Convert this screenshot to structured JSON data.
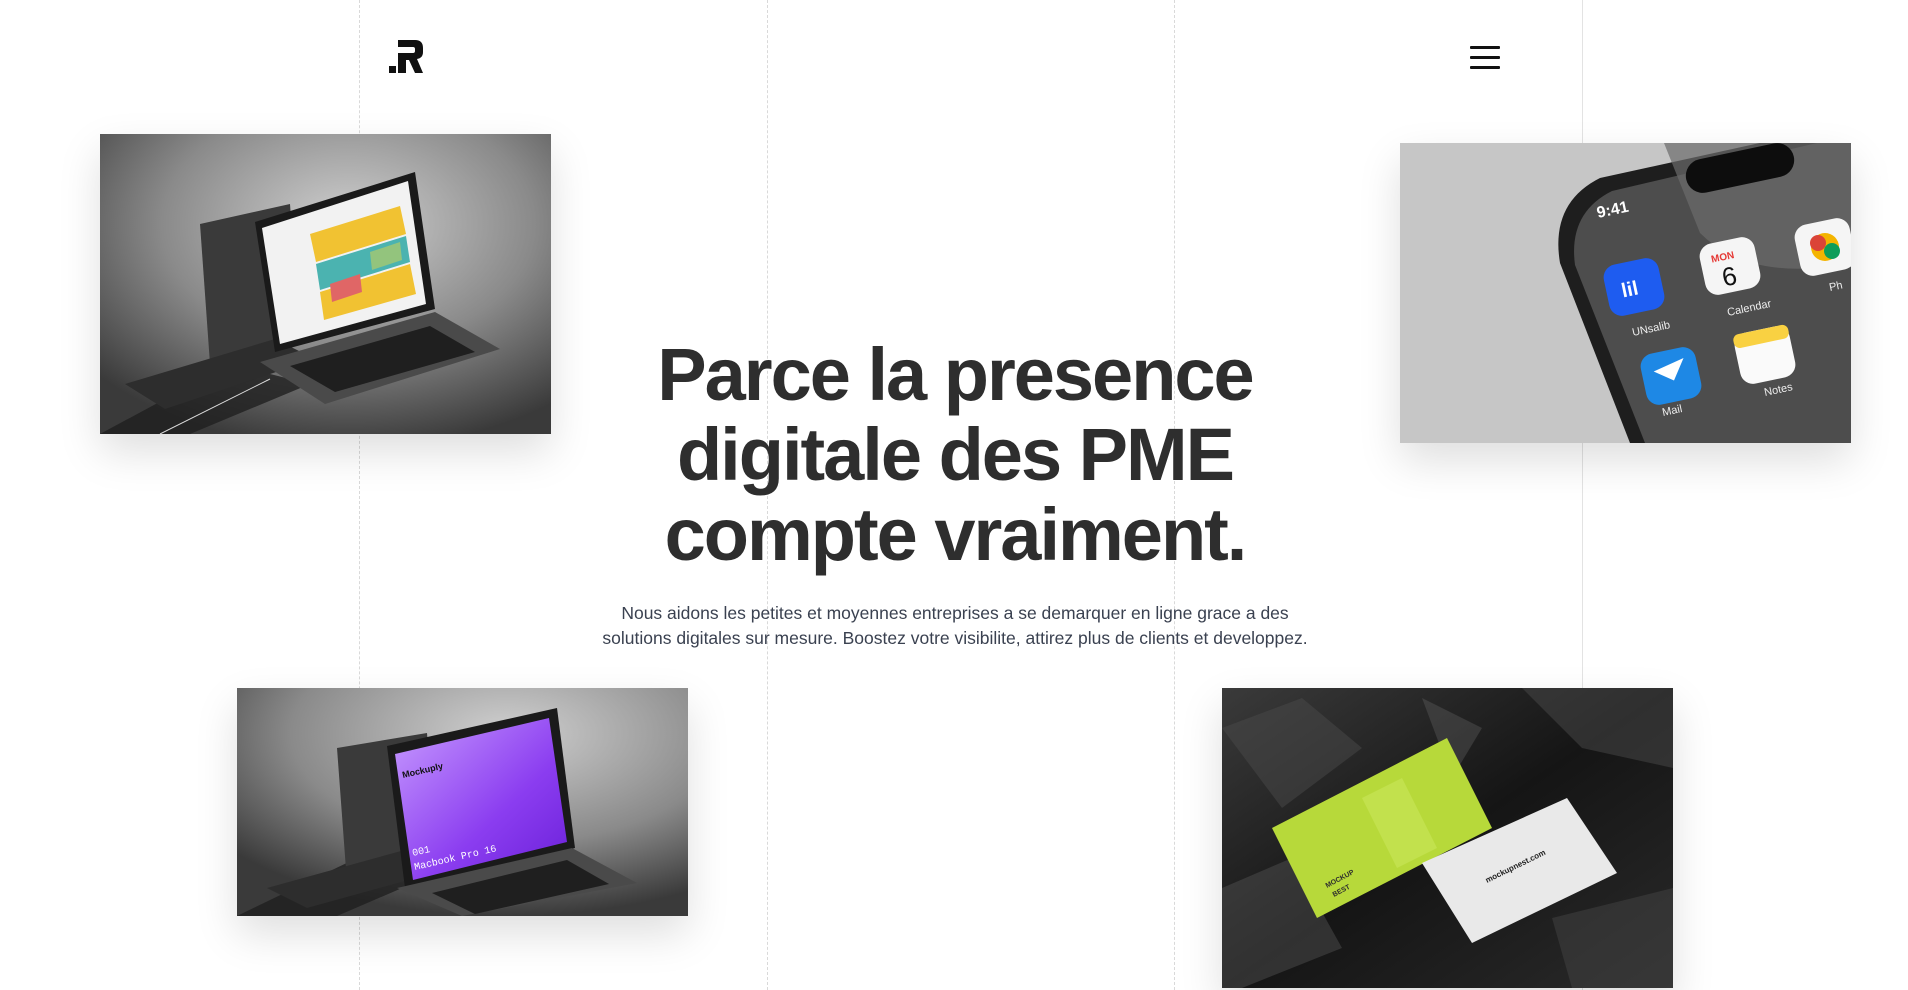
{
  "header": {
    "logo_icon": "brand-r-logo-icon",
    "menu_icon": "hamburger-menu-icon"
  },
  "hero": {
    "title_line1": "Parce la presence",
    "title_line2": "digitale des PME",
    "title_line3": "compte vraiment.",
    "subtitle_line1": "Nous aidons les petites et moyennes entreprises a se demarquer en ligne grace a des",
    "subtitle_line2": "solutions digitales sur mesure. Boostez votre visibilite, attirez plus de clients et developpez."
  },
  "gallery": {
    "laptop_top": {
      "icon": "laptop-mockup-image"
    },
    "phone": {
      "icon": "phone-mockup-image",
      "time": "9:41",
      "app_unsalib": "UNsalib",
      "app_calendar": "Calendar",
      "calendar_day_name": "MON",
      "calendar_day_number": "6",
      "app_photos": "Ph",
      "app_mail": "Mail",
      "app_notes": "Notes"
    },
    "laptop_bottom": {
      "icon": "laptop-mockup-image",
      "screen_brand": "Mockuply",
      "screen_line1": "001",
      "screen_line2": "Macbook Pro 16"
    },
    "business_cards": {
      "icon": "business-cards-mockup-image",
      "card_text1": "MOCKUP",
      "card_text2": "BEST",
      "card_site": "mockupnest.com"
    }
  },
  "colors": {
    "title": "#2e2e2e",
    "subtitle": "#3a4150",
    "accent_purple": "#8b3df0",
    "accent_lime": "#b7d93a",
    "ios_blue": "#1e5cf0"
  }
}
